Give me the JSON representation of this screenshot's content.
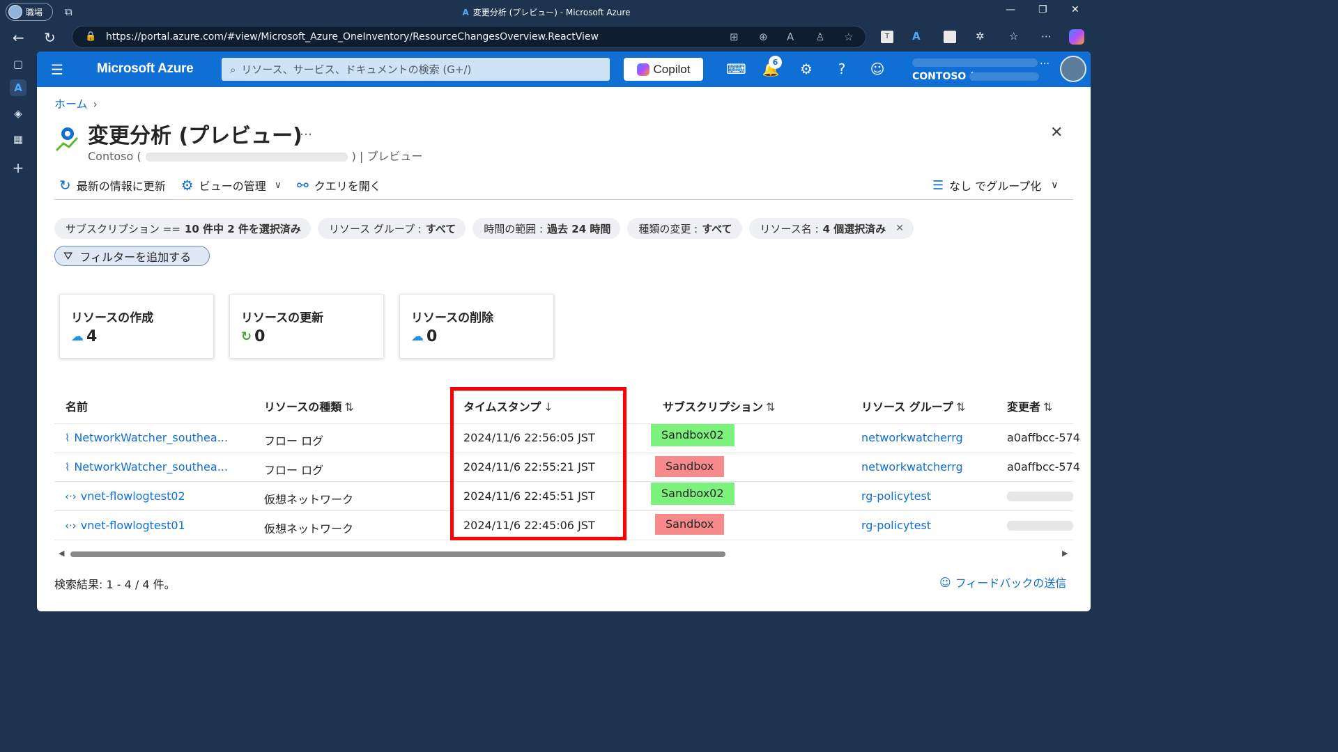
{
  "browser": {
    "profile_label": "職場",
    "window_title": "変更分析 (プレビュー) - Microsoft Azure",
    "url": "https://portal.azure.com/#view/Microsoft_Azure_OneInventory/ResourceChangesOverview.ReactView",
    "ext_badge": "T"
  },
  "portal": {
    "brand": "Microsoft Azure",
    "search_placeholder": "リソース、サービス、ドキュメントの検索 (G+/)",
    "copilot_label": "Copilot",
    "notification_count": "6",
    "tenant": "CONTOSO (",
    "more": "…"
  },
  "breadcrumb": {
    "home": "ホーム"
  },
  "page": {
    "title": "変更分析 (プレビュー)",
    "more": "…",
    "subtitle_tenant": "Contoso (",
    "subtitle_suffix": ") | プレビュー"
  },
  "toolbar": {
    "refresh": "最新の情報に更新",
    "manage_view": "ビューの管理",
    "open_query": "クエリを開く",
    "group_by": "なし でグループ化"
  },
  "filters": [
    {
      "key": "サブスクリプション ==",
      "value": "10 件中 2 件を選択済み"
    },
    {
      "key": "リソース グループ :",
      "value": "すべて"
    },
    {
      "key": "時間の範囲 :",
      "value": "過去 24 時間"
    },
    {
      "key": "種類の変更 :",
      "value": "すべて"
    },
    {
      "key": "リソース名 :",
      "value": "4 個選択済み"
    }
  ],
  "add_filter": "フィルターを追加する",
  "summary": [
    {
      "title": "リソースの作成",
      "value": "4"
    },
    {
      "title": "リソースの更新",
      "value": "0"
    },
    {
      "title": "リソースの削除",
      "value": "0"
    }
  ],
  "table": {
    "headers": {
      "name": "名前",
      "type": "リソースの種類",
      "timestamp": "タイムスタンプ",
      "subscription": "サブスクリプション",
      "resource_group": "リソース グループ",
      "changed_by": "変更者"
    },
    "sort_icons": {
      "sorted": "↓",
      "unsorted": "⇅"
    },
    "rows": [
      {
        "name": "NetworkWatcher_southea...",
        "type": "フロー ログ",
        "timestamp": "2024/11/6 22:56:05 JST",
        "subscription": "Sandbox02",
        "resource_group": "networkwatcherrg",
        "changed_by": "a0affbcc-574"
      },
      {
        "name": "NetworkWatcher_southea...",
        "type": "フロー ログ",
        "timestamp": "2024/11/6 22:55:21 JST",
        "subscription": "Sandbox",
        "resource_group": "networkwatcherrg",
        "changed_by": "a0affbcc-574"
      },
      {
        "name": "vnet-flowlogtest02",
        "type": "仮想ネットワーク",
        "timestamp": "2024/11/6 22:45:51 JST",
        "subscription": "Sandbox02",
        "resource_group": "rg-policytest",
        "changed_by": ""
      },
      {
        "name": "vnet-flowlogtest01",
        "type": "仮想ネットワーク",
        "timestamp": "2024/11/6 22:45:06 JST",
        "subscription": "Sandbox",
        "resource_group": "rg-policytest",
        "changed_by": ""
      }
    ]
  },
  "footer": {
    "results": "検索結果: 1 - 4 / 4 件。",
    "feedback": "フィードバックの送信"
  },
  "colors": {
    "azure_blue": "#0f6fd5",
    "sandbox02_tag": "#7cf27c",
    "sandbox_tag": "#f78a8a",
    "highlight": "#ff0000"
  }
}
